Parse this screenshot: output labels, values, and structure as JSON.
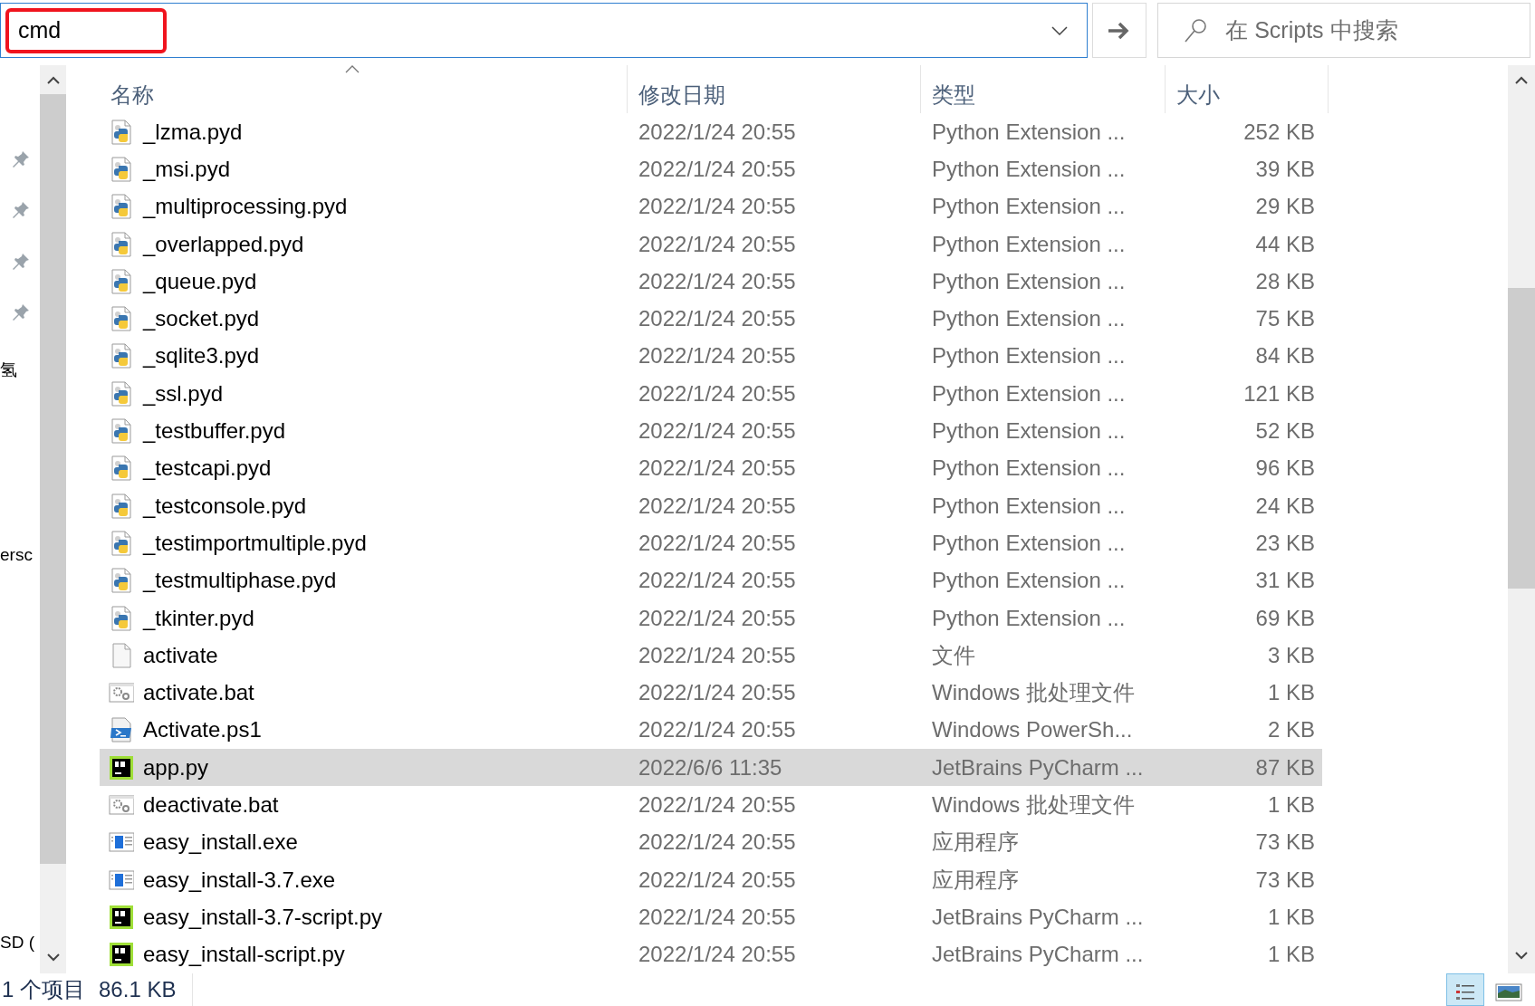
{
  "address_bar": {
    "value": "cmd",
    "highlighted": true
  },
  "search": {
    "placeholder": "在 Scripts 中搜索"
  },
  "nav_pane": {
    "items": [
      {
        "label": "氢"
      },
      {
        "label": "ersc"
      },
      {
        "label": "SD ("
      }
    ]
  },
  "columns": [
    {
      "label": "名称",
      "sorted": true
    },
    {
      "label": "修改日期",
      "sorted": false
    },
    {
      "label": "类型",
      "sorted": false
    },
    {
      "label": "大小",
      "sorted": false
    }
  ],
  "rows": [
    {
      "name": "_lzma.pyd",
      "date": "2022/1/24 20:55",
      "type": "Python Extension ...",
      "size": "252 KB",
      "kind": "pyd",
      "selected": false
    },
    {
      "name": "_msi.pyd",
      "date": "2022/1/24 20:55",
      "type": "Python Extension ...",
      "size": "39 KB",
      "kind": "pyd",
      "selected": false
    },
    {
      "name": "_multiprocessing.pyd",
      "date": "2022/1/24 20:55",
      "type": "Python Extension ...",
      "size": "29 KB",
      "kind": "pyd",
      "selected": false
    },
    {
      "name": "_overlapped.pyd",
      "date": "2022/1/24 20:55",
      "type": "Python Extension ...",
      "size": "44 KB",
      "kind": "pyd",
      "selected": false
    },
    {
      "name": "_queue.pyd",
      "date": "2022/1/24 20:55",
      "type": "Python Extension ...",
      "size": "28 KB",
      "kind": "pyd",
      "selected": false
    },
    {
      "name": "_socket.pyd",
      "date": "2022/1/24 20:55",
      "type": "Python Extension ...",
      "size": "75 KB",
      "kind": "pyd",
      "selected": false
    },
    {
      "name": "_sqlite3.pyd",
      "date": "2022/1/24 20:55",
      "type": "Python Extension ...",
      "size": "84 KB",
      "kind": "pyd",
      "selected": false
    },
    {
      "name": "_ssl.pyd",
      "date": "2022/1/24 20:55",
      "type": "Python Extension ...",
      "size": "121 KB",
      "kind": "pyd",
      "selected": false
    },
    {
      "name": "_testbuffer.pyd",
      "date": "2022/1/24 20:55",
      "type": "Python Extension ...",
      "size": "52 KB",
      "kind": "pyd",
      "selected": false
    },
    {
      "name": "_testcapi.pyd",
      "date": "2022/1/24 20:55",
      "type": "Python Extension ...",
      "size": "96 KB",
      "kind": "pyd",
      "selected": false
    },
    {
      "name": "_testconsole.pyd",
      "date": "2022/1/24 20:55",
      "type": "Python Extension ...",
      "size": "24 KB",
      "kind": "pyd",
      "selected": false
    },
    {
      "name": "_testimportmultiple.pyd",
      "date": "2022/1/24 20:55",
      "type": "Python Extension ...",
      "size": "23 KB",
      "kind": "pyd",
      "selected": false
    },
    {
      "name": "_testmultiphase.pyd",
      "date": "2022/1/24 20:55",
      "type": "Python Extension ...",
      "size": "31 KB",
      "kind": "pyd",
      "selected": false
    },
    {
      "name": "_tkinter.pyd",
      "date": "2022/1/24 20:55",
      "type": "Python Extension ...",
      "size": "69 KB",
      "kind": "pyd",
      "selected": false
    },
    {
      "name": "activate",
      "date": "2022/1/24 20:55",
      "type": "文件",
      "size": "3 KB",
      "kind": "file",
      "selected": false
    },
    {
      "name": "activate.bat",
      "date": "2022/1/24 20:55",
      "type": "Windows 批处理文件",
      "size": "1 KB",
      "kind": "bat",
      "selected": false
    },
    {
      "name": "Activate.ps1",
      "date": "2022/1/24 20:55",
      "type": "Windows PowerSh...",
      "size": "2 KB",
      "kind": "ps1",
      "selected": false
    },
    {
      "name": "app.py",
      "date": "2022/6/6 11:35",
      "type": "JetBrains PyCharm ...",
      "size": "87 KB",
      "kind": "pycharm",
      "selected": true
    },
    {
      "name": "deactivate.bat",
      "date": "2022/1/24 20:55",
      "type": "Windows 批处理文件",
      "size": "1 KB",
      "kind": "bat",
      "selected": false
    },
    {
      "name": "easy_install.exe",
      "date": "2022/1/24 20:55",
      "type": "应用程序",
      "size": "73 KB",
      "kind": "exe",
      "selected": false
    },
    {
      "name": "easy_install-3.7.exe",
      "date": "2022/1/24 20:55",
      "type": "应用程序",
      "size": "73 KB",
      "kind": "exe",
      "selected": false
    },
    {
      "name": "easy_install-3.7-script.py",
      "date": "2022/1/24 20:55",
      "type": "JetBrains PyCharm ...",
      "size": "1 KB",
      "kind": "pycharm",
      "selected": false
    },
    {
      "name": "easy_install-script.py",
      "date": "2022/1/24 20:55",
      "type": "JetBrains PyCharm ...",
      "size": "1 KB",
      "kind": "pycharm",
      "selected": false
    }
  ],
  "status_bar": {
    "count": "1 个项目",
    "size": "86.1 KB"
  },
  "view_buttons": [
    {
      "kind": "details",
      "selected": true
    },
    {
      "kind": "tiles",
      "selected": false
    }
  ]
}
